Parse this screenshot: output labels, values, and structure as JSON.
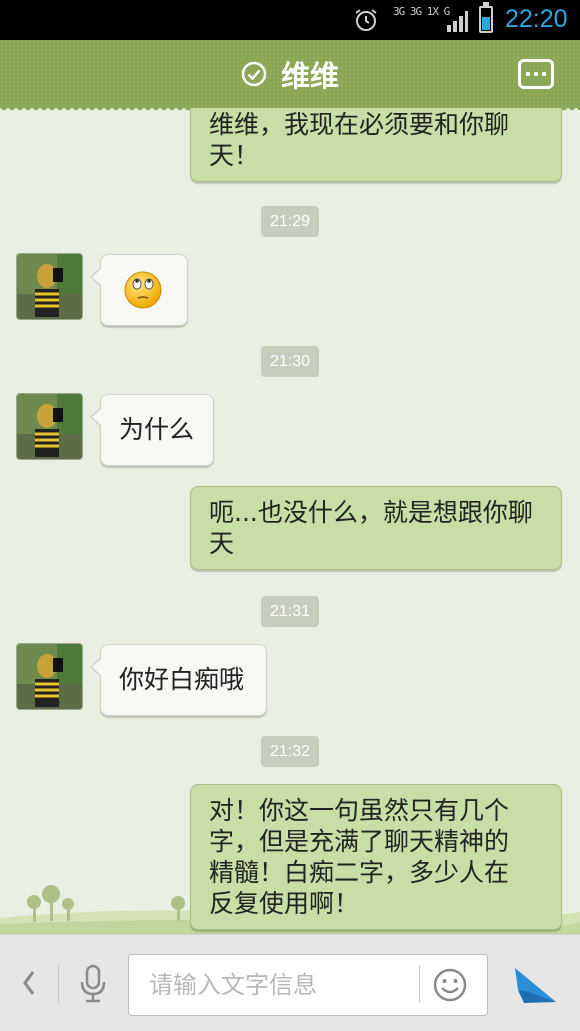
{
  "status_bar": {
    "time": "22:20",
    "network": "3G 3G 1X G",
    "colors": {
      "accent": "#2aa7e0"
    }
  },
  "header": {
    "title": "维维",
    "verified_icon": "check-circle-icon",
    "menu_icon": "more-icon"
  },
  "messages": [
    {
      "type": "text",
      "direction": "outgoing",
      "text_lines": [
        "维维，我现在必须要和你聊",
        "天！"
      ]
    },
    {
      "type": "time",
      "text": "21:29"
    },
    {
      "type": "emoji",
      "direction": "incoming",
      "emoji_name": "eye-roll-face-icon"
    },
    {
      "type": "time",
      "text": "21:30"
    },
    {
      "type": "text",
      "direction": "incoming",
      "text_lines": [
        "为什么"
      ]
    },
    {
      "type": "text",
      "direction": "outgoing",
      "text_lines": [
        "呃...也没什么，就是想跟你聊",
        "天"
      ]
    },
    {
      "type": "time",
      "text": "21:31"
    },
    {
      "type": "text",
      "direction": "incoming",
      "text_lines": [
        "你好白痴哦"
      ]
    },
    {
      "type": "time",
      "text": "21:32"
    },
    {
      "type": "text",
      "direction": "outgoing",
      "text_lines": [
        "对！你这一句虽然只有几个",
        "字，但是充满了聊天精神的",
        "精髓！白痴二字，多少人在",
        "反复使用啊！"
      ]
    }
  ],
  "input_bar": {
    "placeholder": "请输入文字信息",
    "value": "",
    "icons": [
      "chevron-left-icon",
      "microphone-icon",
      "smiley-icon",
      "send-icon"
    ]
  },
  "theme": {
    "header_green": "#8aa756",
    "outgoing_bubble": "#c9dda6",
    "incoming_bubble": "#f7f7f4",
    "chat_background": "#e9efe1"
  }
}
